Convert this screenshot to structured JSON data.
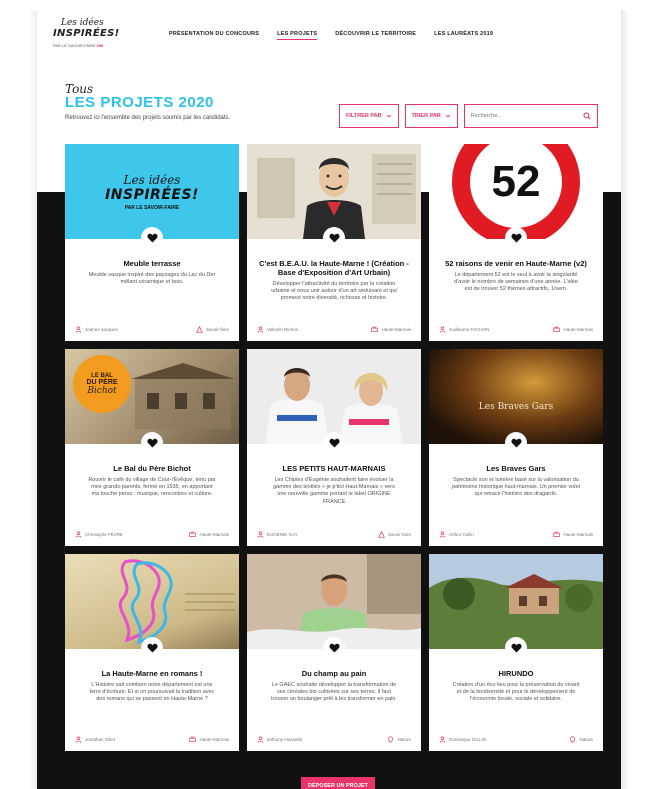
{
  "header": {
    "logo": {
      "line1": "Les idées",
      "line2": "INSPIRÉES!",
      "line3": "PAR LE SAVOIR-FAIRE",
      "line3_brand": "HM"
    },
    "nav": [
      {
        "label": "PRÉSENTATION DU CONCOURS",
        "active": false
      },
      {
        "label": "LES PROJETS",
        "active": true
      },
      {
        "label": "DÉCOUVRIR LE TERRITOIRE",
        "active": false
      },
      {
        "label": "LES LAURÉATS 2019",
        "active": false
      }
    ]
  },
  "page": {
    "script_title": "Tous",
    "title": "LES PROJETS 2020",
    "subtitle": "Retrouvez ici l'ensemble des projets soumis par les candidats."
  },
  "filters": {
    "filter_label": "FILTRER PAR",
    "sort_label": "TRIER PAR",
    "search_placeholder": "Recherche..."
  },
  "projects": [
    {
      "title": "Meuble terrasse",
      "desc": "Meuble vasque inspiré des paysages du Lac du Der mêlant céramique et bois.",
      "author": "Joanne Jacques",
      "category": "Savoir-faire",
      "image": "logo-inspirees"
    },
    {
      "title": "C'est B.E.A.U. la Haute-Marne ! (Création - Base d'Exposition d'Art Urbain)",
      "desc": "Développer l'attractivité du territoire par la création urbaine et nous unir autour d'un art séduisant et qui promeut notre diversité, richesse et histoire.",
      "author": "Valentin Richon",
      "category": "Haute-Marnais",
      "image": "sketch-portrait"
    },
    {
      "title": "52 raisons de venir en Haute-Marne (v2)",
      "desc": "Le département 52 est le seul à avoir la singularité d'avoir le nombre de semaines d'une année. L'idée est de trouver 52 thèmes attractifs, 1/sem.",
      "author": "Guillaume FACHON",
      "category": "Haute-Marnais",
      "image": "sign-52"
    },
    {
      "title": "Le Bal du Père Bichot",
      "desc": "Rouvrir le café du village de Cour-l'Évêque, tenu par mes grands-parents, fermé en 1935, en apportant ma touche perso : musique, rencontres et culture.",
      "author": "Christophe FÈVRE",
      "category": "Haute-Marnais",
      "image": "bal-pere-bichot"
    },
    {
      "title": "LES PETITS HAUT-MARNAIS",
      "desc": "Les Chipies d'Eugénie souhaitent faire évoluer la gamme des textiles « je p'tiot Haut-Marnais » vers une nouvelle gamme portant le label ORIGINE FRANCE",
      "author": "EUGÉNIE GAY",
      "category": "Savoir-faire",
      "image": "couple-tshirts"
    },
    {
      "title": "Les Braves Gars",
      "desc": "Spectacle son et lumière basé sur la valorisation du patrimoine historique haut-marnais. Un premier volet qui retrace l'histoire des dragards.",
      "author": "Arthur Collin",
      "category": "Haute-Marnais",
      "image": "braves-gars"
    },
    {
      "title": "La Haute-Marne en romans !",
      "desc": "L'Histoire sait combien notre département est une terre d'écriture. Et si on poursuivait la tradition avec des romans qui se passent en Haute-Marne ?",
      "author": "Jonathan Gillet",
      "category": "Haute-Marnais",
      "image": "map-book"
    },
    {
      "title": "Du champ au pain",
      "desc": "Le GAEC souhaite développer la transformation de ses céréales bio cultivées sur ses terres. Il faut trouver un boulanger prêt à les transformer en pain.",
      "author": "anthony massebit",
      "category": "Nature",
      "image": "baker"
    },
    {
      "title": "HIRUNDO",
      "desc": "Création d'un éco lieu pour la préservation du vivant et de la biodiversité et pour le développement de l'économie locale, sociale et solidaire.",
      "author": "Dominique GILLIN",
      "category": "Nature",
      "image": "countryside"
    }
  ],
  "footer": {
    "submit_label": "DÉPOSER UN PROJET"
  },
  "colors": {
    "accent": "#e8336b",
    "title_blue": "#2dc3e8",
    "band": "#111111"
  },
  "icons": {
    "heart": "heart-icon",
    "user": "user-icon",
    "category": "category-icon",
    "search": "search-icon",
    "chevron": "chevron-down-icon"
  }
}
